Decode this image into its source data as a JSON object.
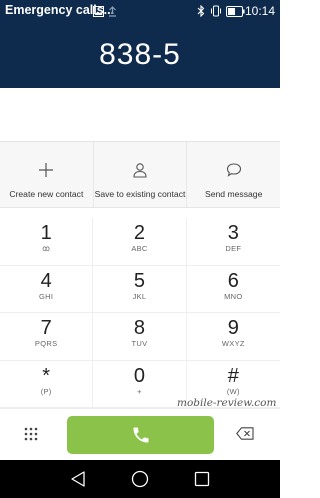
{
  "status_bar": {
    "title": "Emergency calls...",
    "time": "10:14",
    "icons": [
      "image-icon",
      "upload-icon",
      "bluetooth-icon",
      "vibrate-icon",
      "battery-icon"
    ]
  },
  "dialer": {
    "number": "838-5"
  },
  "actions": [
    {
      "label": "Create new contact",
      "icon": "plus-icon"
    },
    {
      "label": "Save to existing contact",
      "icon": "person-icon"
    },
    {
      "label": "Send message",
      "icon": "chat-bubble-icon"
    }
  ],
  "keypad": [
    {
      "digit": "1",
      "letters": "ꝏ"
    },
    {
      "digit": "2",
      "letters": "ABC"
    },
    {
      "digit": "3",
      "letters": "DEF"
    },
    {
      "digit": "4",
      "letters": "GHI"
    },
    {
      "digit": "5",
      "letters": "JKL"
    },
    {
      "digit": "6",
      "letters": "MNO"
    },
    {
      "digit": "7",
      "letters": "PQRS"
    },
    {
      "digit": "8",
      "letters": "TUV"
    },
    {
      "digit": "9",
      "letters": "WXYZ"
    },
    {
      "digit": "*",
      "letters": "(P)"
    },
    {
      "digit": "0",
      "letters": "+"
    },
    {
      "digit": "#",
      "letters": "(W)"
    }
  ],
  "watermark": "mobile-review.com",
  "colors": {
    "header": "#0e2a4c",
    "call": "#8bc34a",
    "nav": "#000000"
  }
}
